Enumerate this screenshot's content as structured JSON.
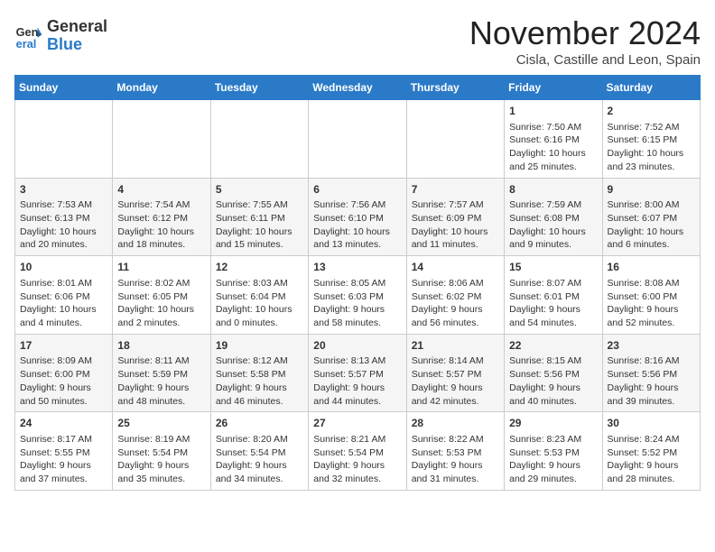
{
  "header": {
    "logo_line1": "General",
    "logo_line2": "Blue",
    "month": "November 2024",
    "location": "Cisla, Castille and Leon, Spain"
  },
  "days_of_week": [
    "Sunday",
    "Monday",
    "Tuesday",
    "Wednesday",
    "Thursday",
    "Friday",
    "Saturday"
  ],
  "weeks": [
    [
      {
        "day": "",
        "info": ""
      },
      {
        "day": "",
        "info": ""
      },
      {
        "day": "",
        "info": ""
      },
      {
        "day": "",
        "info": ""
      },
      {
        "day": "",
        "info": ""
      },
      {
        "day": "1",
        "info": "Sunrise: 7:50 AM\nSunset: 6:16 PM\nDaylight: 10 hours and 25 minutes."
      },
      {
        "day": "2",
        "info": "Sunrise: 7:52 AM\nSunset: 6:15 PM\nDaylight: 10 hours and 23 minutes."
      }
    ],
    [
      {
        "day": "3",
        "info": "Sunrise: 7:53 AM\nSunset: 6:13 PM\nDaylight: 10 hours and 20 minutes."
      },
      {
        "day": "4",
        "info": "Sunrise: 7:54 AM\nSunset: 6:12 PM\nDaylight: 10 hours and 18 minutes."
      },
      {
        "day": "5",
        "info": "Sunrise: 7:55 AM\nSunset: 6:11 PM\nDaylight: 10 hours and 15 minutes."
      },
      {
        "day": "6",
        "info": "Sunrise: 7:56 AM\nSunset: 6:10 PM\nDaylight: 10 hours and 13 minutes."
      },
      {
        "day": "7",
        "info": "Sunrise: 7:57 AM\nSunset: 6:09 PM\nDaylight: 10 hours and 11 minutes."
      },
      {
        "day": "8",
        "info": "Sunrise: 7:59 AM\nSunset: 6:08 PM\nDaylight: 10 hours and 9 minutes."
      },
      {
        "day": "9",
        "info": "Sunrise: 8:00 AM\nSunset: 6:07 PM\nDaylight: 10 hours and 6 minutes."
      }
    ],
    [
      {
        "day": "10",
        "info": "Sunrise: 8:01 AM\nSunset: 6:06 PM\nDaylight: 10 hours and 4 minutes."
      },
      {
        "day": "11",
        "info": "Sunrise: 8:02 AM\nSunset: 6:05 PM\nDaylight: 10 hours and 2 minutes."
      },
      {
        "day": "12",
        "info": "Sunrise: 8:03 AM\nSunset: 6:04 PM\nDaylight: 10 hours and 0 minutes."
      },
      {
        "day": "13",
        "info": "Sunrise: 8:05 AM\nSunset: 6:03 PM\nDaylight: 9 hours and 58 minutes."
      },
      {
        "day": "14",
        "info": "Sunrise: 8:06 AM\nSunset: 6:02 PM\nDaylight: 9 hours and 56 minutes."
      },
      {
        "day": "15",
        "info": "Sunrise: 8:07 AM\nSunset: 6:01 PM\nDaylight: 9 hours and 54 minutes."
      },
      {
        "day": "16",
        "info": "Sunrise: 8:08 AM\nSunset: 6:00 PM\nDaylight: 9 hours and 52 minutes."
      }
    ],
    [
      {
        "day": "17",
        "info": "Sunrise: 8:09 AM\nSunset: 6:00 PM\nDaylight: 9 hours and 50 minutes."
      },
      {
        "day": "18",
        "info": "Sunrise: 8:11 AM\nSunset: 5:59 PM\nDaylight: 9 hours and 48 minutes."
      },
      {
        "day": "19",
        "info": "Sunrise: 8:12 AM\nSunset: 5:58 PM\nDaylight: 9 hours and 46 minutes."
      },
      {
        "day": "20",
        "info": "Sunrise: 8:13 AM\nSunset: 5:57 PM\nDaylight: 9 hours and 44 minutes."
      },
      {
        "day": "21",
        "info": "Sunrise: 8:14 AM\nSunset: 5:57 PM\nDaylight: 9 hours and 42 minutes."
      },
      {
        "day": "22",
        "info": "Sunrise: 8:15 AM\nSunset: 5:56 PM\nDaylight: 9 hours and 40 minutes."
      },
      {
        "day": "23",
        "info": "Sunrise: 8:16 AM\nSunset: 5:56 PM\nDaylight: 9 hours and 39 minutes."
      }
    ],
    [
      {
        "day": "24",
        "info": "Sunrise: 8:17 AM\nSunset: 5:55 PM\nDaylight: 9 hours and 37 minutes."
      },
      {
        "day": "25",
        "info": "Sunrise: 8:19 AM\nSunset: 5:54 PM\nDaylight: 9 hours and 35 minutes."
      },
      {
        "day": "26",
        "info": "Sunrise: 8:20 AM\nSunset: 5:54 PM\nDaylight: 9 hours and 34 minutes."
      },
      {
        "day": "27",
        "info": "Sunrise: 8:21 AM\nSunset: 5:54 PM\nDaylight: 9 hours and 32 minutes."
      },
      {
        "day": "28",
        "info": "Sunrise: 8:22 AM\nSunset: 5:53 PM\nDaylight: 9 hours and 31 minutes."
      },
      {
        "day": "29",
        "info": "Sunrise: 8:23 AM\nSunset: 5:53 PM\nDaylight: 9 hours and 29 minutes."
      },
      {
        "day": "30",
        "info": "Sunrise: 8:24 AM\nSunset: 5:52 PM\nDaylight: 9 hours and 28 minutes."
      }
    ]
  ]
}
